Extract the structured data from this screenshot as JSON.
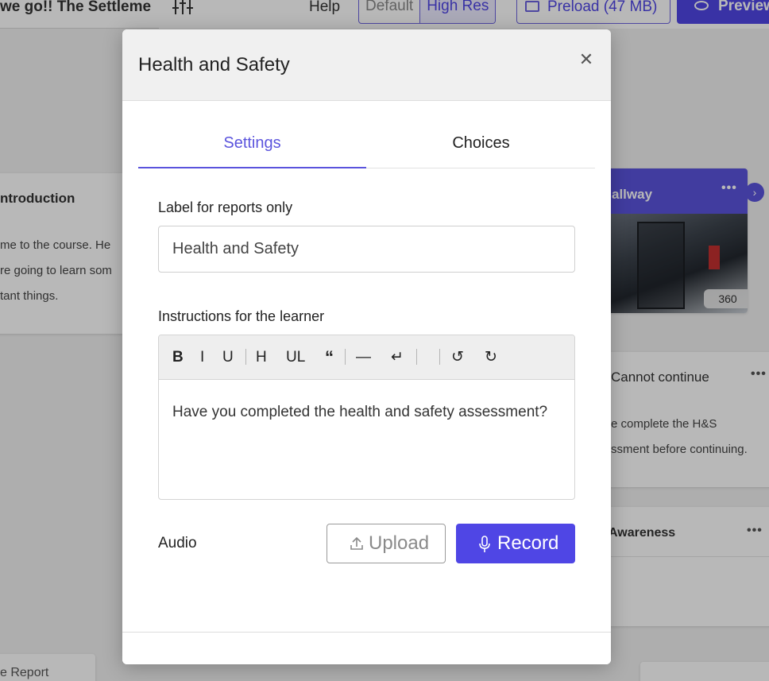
{
  "app": {
    "course_title": "we go!!  The Settleme",
    "help_label": "Help",
    "resolution": {
      "default_label": "Default",
      "high_label": "High Res",
      "selected": "High Res"
    },
    "preload_label": "Preload (47 MB)",
    "preview_label": "Preview"
  },
  "background_cards": {
    "introduction": {
      "title": "ntroduction",
      "lines": [
        "me to the course. He",
        "re going to learn som",
        "tant things."
      ]
    },
    "hallway": {
      "title": "allway",
      "badge": "360",
      "menu_icon": "more-icon"
    },
    "cannot_continue": {
      "title": "Cannot continue",
      "lines": [
        "e complete the H&S",
        "ssment before continuing."
      ]
    },
    "awareness": {
      "title": "Awareness"
    },
    "report": {
      "label": "e Report"
    }
  },
  "modal": {
    "title": "Health and Safety",
    "tabs": [
      {
        "label": "Settings",
        "active": true
      },
      {
        "label": "Choices",
        "active": false
      }
    ],
    "label_field": {
      "label": "Label for reports only",
      "value": "Health and Safety"
    },
    "instructions": {
      "label": "Instructions for the learner",
      "toolbar": {
        "bold": "B",
        "italic": "I",
        "underline": "U",
        "heading": "H",
        "list": "UL",
        "quote": "“",
        "rule": "—",
        "line_break": "↵",
        "undo": "↺",
        "redo": "↻"
      },
      "text": "Have you completed the health and safety assessment?"
    },
    "audio": {
      "label": "Audio",
      "upload_label": "Upload",
      "record_label": "Record"
    }
  },
  "colors": {
    "accent": "#4f46e5",
    "tab_active": "#5b54dd"
  }
}
